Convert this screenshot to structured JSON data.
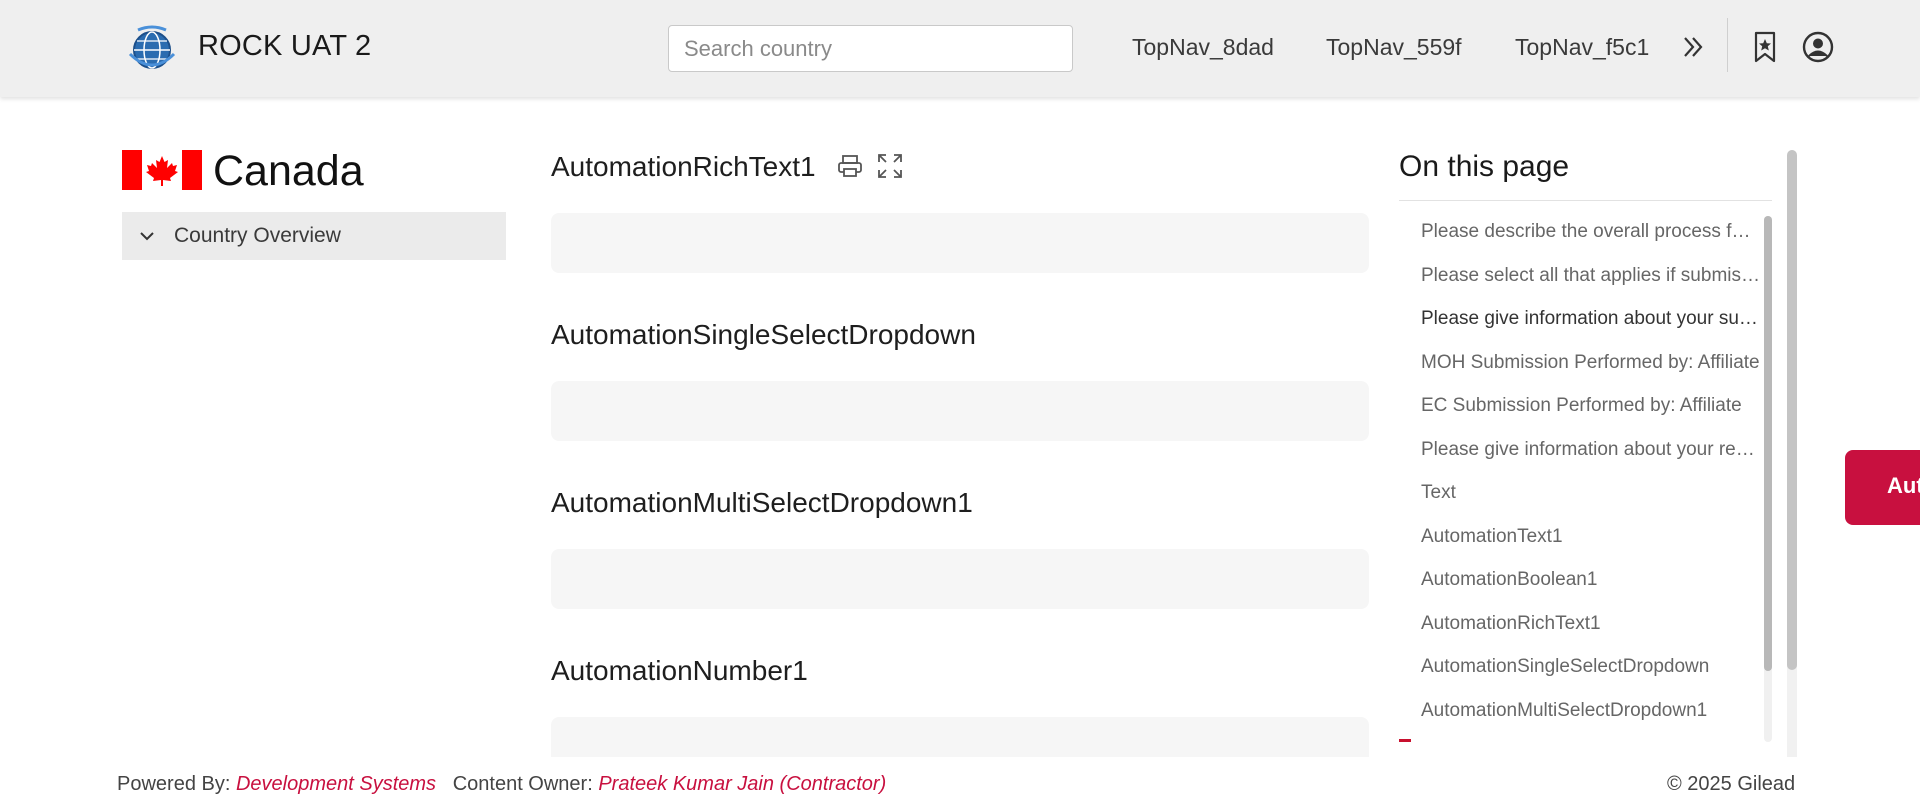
{
  "header": {
    "app_title": "ROCK UAT 2",
    "search_placeholder": "Search country",
    "search_value": "",
    "top_nav": [
      "TopNav_8dad",
      "TopNav_559f",
      "TopNav_f5c1"
    ],
    "icons": {
      "logo": "globe-logo-icon",
      "more": "double-chevron-right-icon",
      "bookmark": "bookmark-star-icon",
      "profile": "user-profile-icon"
    }
  },
  "sidebar": {
    "country": "Canada",
    "flag_icon": "canada-flag-icon",
    "items": [
      {
        "label": "Country Overview",
        "icon": "chevron-down-icon"
      }
    ]
  },
  "main": {
    "sections": [
      {
        "title": "AutomationRichText1",
        "value": ""
      },
      {
        "title": "AutomationSingleSelectDropdown",
        "value": ""
      },
      {
        "title": "AutomationMultiSelectDropdown1",
        "value": ""
      },
      {
        "title": "AutomationNumber1",
        "value": ""
      }
    ],
    "tool_icons": [
      "print-icon",
      "fullscreen-expand-icon"
    ]
  },
  "toc": {
    "title": "On this page",
    "items": [
      "Please describe the overall process for Ethics Committee and Regulatory submissions",
      "Please select all that applies if submission is required",
      "Please give information about your submission timelines",
      "MOH Submission Performed by: Affiliate",
      "EC Submission Performed by: Affiliate",
      "Please give information about your review timelines",
      "Text",
      "AutomationText1",
      "AutomationBoolean1",
      "AutomationRichText1",
      "AutomationSingleSelectDropdown",
      "AutomationMultiSelectDropdown1"
    ],
    "active_index": 2
  },
  "feedback_tab": {
    "label": "Aut"
  },
  "footer": {
    "powered_by_label": "Powered By:",
    "powered_by_value": "Development Systems",
    "content_owner_label": "Content Owner:",
    "content_owner_value": "Prateek Kumar Jain (Contractor)",
    "copyright": "© 2025 Gilead"
  },
  "colors": {
    "accent": "#c8103f",
    "header_bg": "#efefef",
    "box_bg": "#f6f6f6"
  }
}
